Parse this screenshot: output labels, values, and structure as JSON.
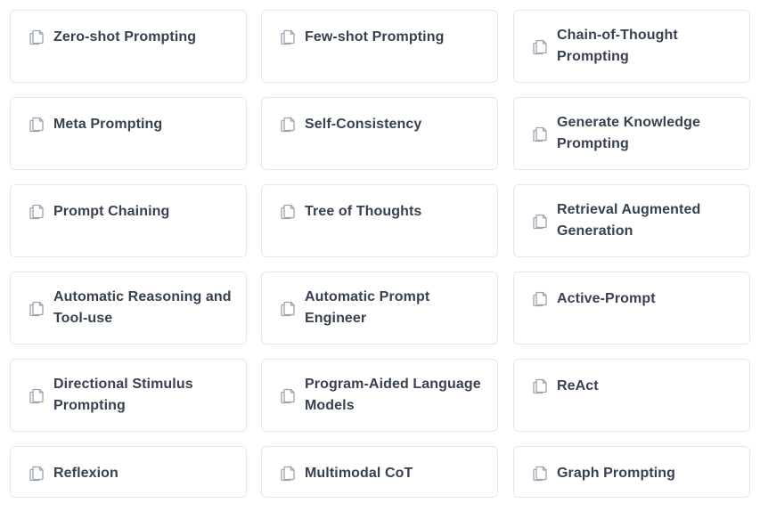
{
  "cards": [
    {
      "label": "Zero-shot Prompting",
      "icon": "document-copy-icon"
    },
    {
      "label": "Few-shot Prompting",
      "icon": "document-copy-icon"
    },
    {
      "label": "Chain-of-Thought Prompting",
      "icon": "document-copy-icon"
    },
    {
      "label": "Meta Prompting",
      "icon": "document-copy-icon"
    },
    {
      "label": "Self-Consistency",
      "icon": "document-copy-icon"
    },
    {
      "label": "Generate Knowledge Prompting",
      "icon": "document-copy-icon"
    },
    {
      "label": "Prompt Chaining",
      "icon": "document-copy-icon"
    },
    {
      "label": "Tree of Thoughts",
      "icon": "document-copy-icon"
    },
    {
      "label": "Retrieval Augmented Generation",
      "icon": "document-copy-icon"
    },
    {
      "label": "Automatic Reasoning and Tool-use",
      "icon": "document-copy-icon"
    },
    {
      "label": "Automatic Prompt Engineer",
      "icon": "document-copy-icon"
    },
    {
      "label": "Active-Prompt",
      "icon": "document-copy-icon"
    },
    {
      "label": "Directional Stimulus Prompting",
      "icon": "document-copy-icon"
    },
    {
      "label": "Program-Aided Language Models",
      "icon": "document-copy-icon"
    },
    {
      "label": "ReAct",
      "icon": "document-copy-icon"
    },
    {
      "label": "Reflexion",
      "icon": "document-copy-icon"
    },
    {
      "label": "Multimodal CoT",
      "icon": "document-copy-icon"
    },
    {
      "label": "Graph Prompting",
      "icon": "document-copy-icon"
    }
  ],
  "colors": {
    "border": "#e5e7eb",
    "text": "#374151",
    "icon": "#9ca3af"
  }
}
